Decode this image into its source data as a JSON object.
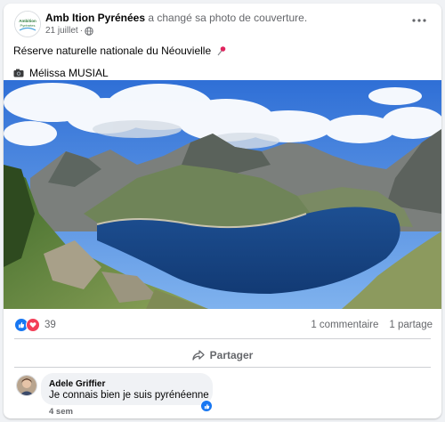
{
  "post": {
    "page_name": "Amb Ition Pyrénées",
    "action_text": "a changé sa photo de couverture.",
    "date": "21 juillet",
    "privacy_icon": "globe-icon",
    "more_icon": "more-horizontal-icon",
    "caption_line1": "Réserve naturelle nationale du Néouvielle",
    "caption_emoji1": "pushpin-icon",
    "caption_emoji2": "camera-icon",
    "caption_line2": "Mélissa MUSIAL"
  },
  "photo": {
    "subject": "mountain-lake-landscape"
  },
  "stats": {
    "reaction_icons": [
      "like-icon",
      "love-icon"
    ],
    "reactions_count": "39",
    "comments": "1 commentaire",
    "shares": "1 partage"
  },
  "actions": {
    "share_label": "Partager",
    "share_icon": "share-arrow-icon"
  },
  "comment": {
    "author": "Adele Griffier",
    "text": "Je connais bien je suis pyrénéenne",
    "time": "4 sem",
    "reaction_icon": "like-icon"
  },
  "colors": {
    "accent": "#1877f2",
    "love": "#f33e58",
    "muted_text": "#65676b",
    "background": "#f0f2f5"
  }
}
